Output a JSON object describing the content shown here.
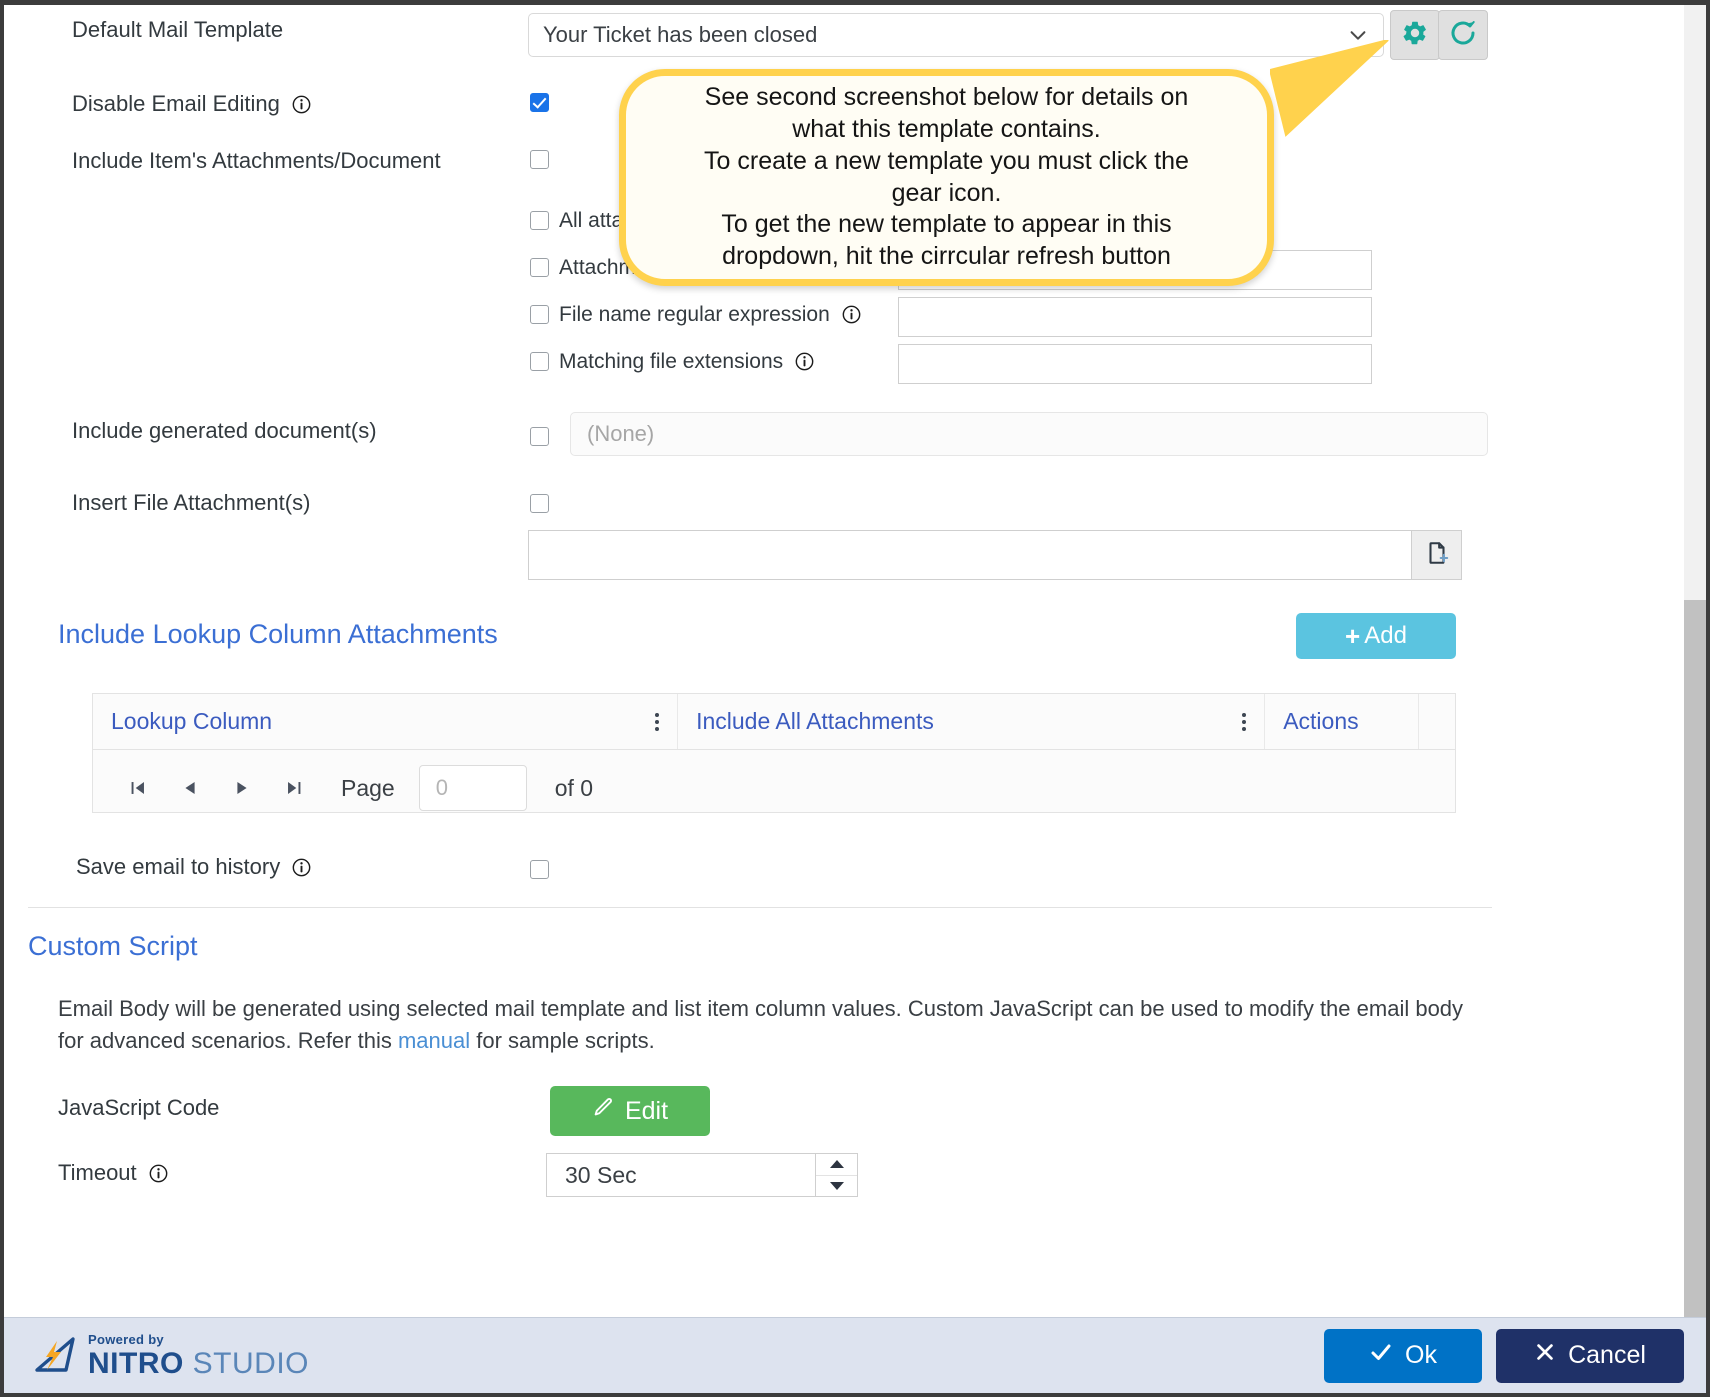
{
  "form": {
    "default_mail_template": {
      "label": "Default Mail Template",
      "selected": "Your Ticket has been closed"
    },
    "disable_email_editing": {
      "label": "Disable Email Editing",
      "checked": true
    },
    "include_item_attachments": {
      "label": "Include Item's Attachments/Document",
      "checked": false
    },
    "sub_options": [
      {
        "label": "All attachments",
        "checked": false
      },
      {
        "label": "Attachment names",
        "checked": false
      },
      {
        "label": "File name regular expression",
        "checked": false
      },
      {
        "label": "Matching file extensions",
        "checked": false
      }
    ],
    "include_generated_documents": {
      "label": "Include generated document(s)",
      "checked": false,
      "value": "(None)"
    },
    "insert_file_attachments": {
      "label": "Insert File Attachment(s)",
      "checked": false,
      "value": ""
    },
    "save_email_to_history": {
      "label": "Save email to history",
      "checked": false
    }
  },
  "lookup_section": {
    "title": "Include Lookup Column Attachments",
    "add_label": "Add",
    "columns": [
      "Lookup Column",
      "Include All Attachments",
      "Actions"
    ],
    "rows": [],
    "pager": {
      "page_label": "Page",
      "page_value": "0",
      "of_label": "of 0"
    }
  },
  "custom_script": {
    "title": "Custom Script",
    "description_part1": "Email Body will be generated using selected mail template and list item column values. Custom JavaScript can be used to modify the email body for advanced scenarios. Refer this ",
    "link_text": "manual",
    "description_part2": " for sample scripts.",
    "javascript_code_label": "JavaScript Code",
    "edit_label": "Edit",
    "timeout_label": "Timeout",
    "timeout_value": "30 Sec"
  },
  "callout": {
    "lines": [
      "See second screenshot below for details on",
      "what this template contains.",
      "To create a new template you must click the",
      "gear icon.",
      "To get the new template to appear in this",
      "dropdown, hit the cirrcular refresh button"
    ]
  },
  "footer": {
    "logo_powered": "Powered by",
    "logo_nitro": "NITRO",
    "logo_studio": " STUDIO",
    "ok_label": "Ok",
    "cancel_label": "Cancel"
  },
  "colors": {
    "link_blue": "#3b6fd4",
    "checkbox_blue": "#1a73e8",
    "add_button": "#5bc4e0",
    "edit_button": "#58b85c",
    "ok_button": "#0072c6",
    "cancel_button": "#1f3168",
    "callout_border": "#ffd24d",
    "icon_teal": "#1aa89a",
    "footer_bg": "#dde3ef"
  }
}
